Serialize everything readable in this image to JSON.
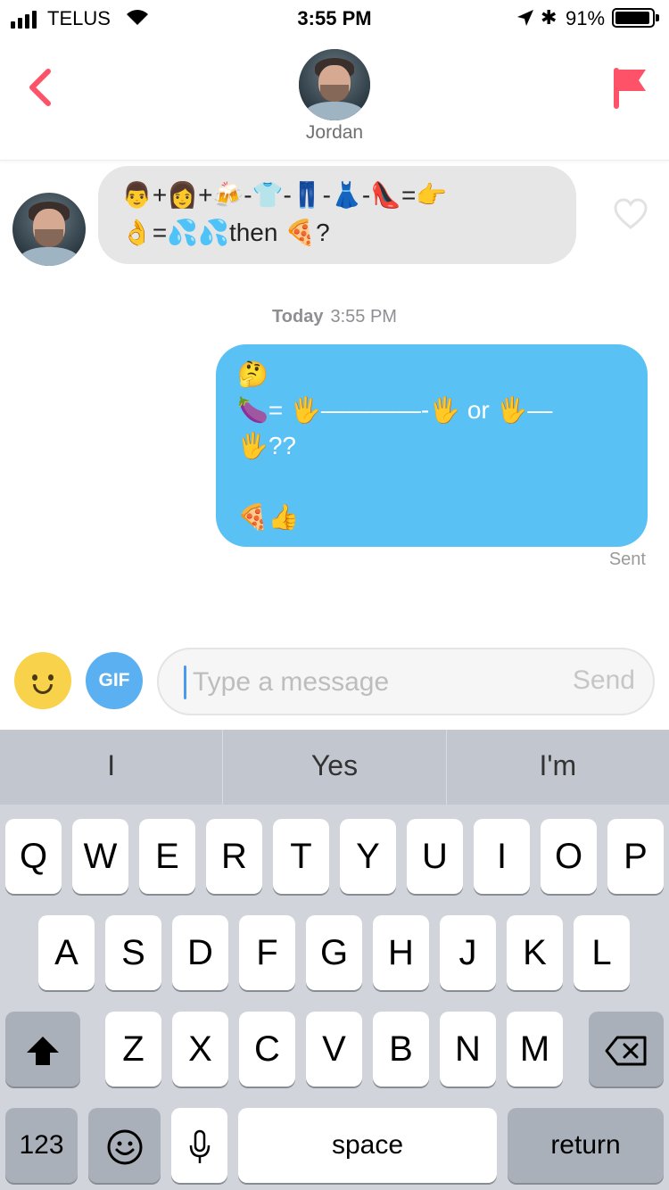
{
  "status_bar": {
    "carrier": "TELUS",
    "time": "3:55 PM",
    "battery_percent": "91%",
    "battery_level": 0.91
  },
  "header": {
    "contact_name": "Jordan"
  },
  "messages": {
    "incoming": {
      "line1": "👨+👩+🍻-👕-👖-👗-👠=👉",
      "line2": "👌=💦💦then 🍕?"
    },
    "timestamp_day": "Today",
    "timestamp_time": "3:55 PM",
    "outgoing": {
      "text": "🤔\n🍆= 🖐————-🖐 or 🖐—\n🖐??\n\n🍕👍"
    },
    "sent_label": "Sent"
  },
  "composer": {
    "gif_label": "GIF",
    "placeholder": "Type a message",
    "send_label": "Send"
  },
  "keyboard": {
    "suggestions": [
      "I",
      "Yes",
      "I'm"
    ],
    "row1": [
      "Q",
      "W",
      "E",
      "R",
      "T",
      "Y",
      "U",
      "I",
      "O",
      "P"
    ],
    "row2": [
      "A",
      "S",
      "D",
      "F",
      "G",
      "H",
      "J",
      "K",
      "L"
    ],
    "row3": [
      "Z",
      "X",
      "C",
      "V",
      "B",
      "N",
      "M"
    ],
    "numbers_label": "123",
    "space_label": "space",
    "return_label": "return"
  },
  "colors": {
    "accent": "#fe5268",
    "outgoing_bubble": "#5ac1f5",
    "incoming_bubble": "#e6e6e6",
    "gif_button": "#5ab0f0"
  },
  "icons": [
    "back-icon",
    "flag-icon",
    "heart-icon",
    "emoji-icon",
    "shift-icon",
    "backspace-icon",
    "emoji-keyboard-icon",
    "microphone-icon"
  ]
}
